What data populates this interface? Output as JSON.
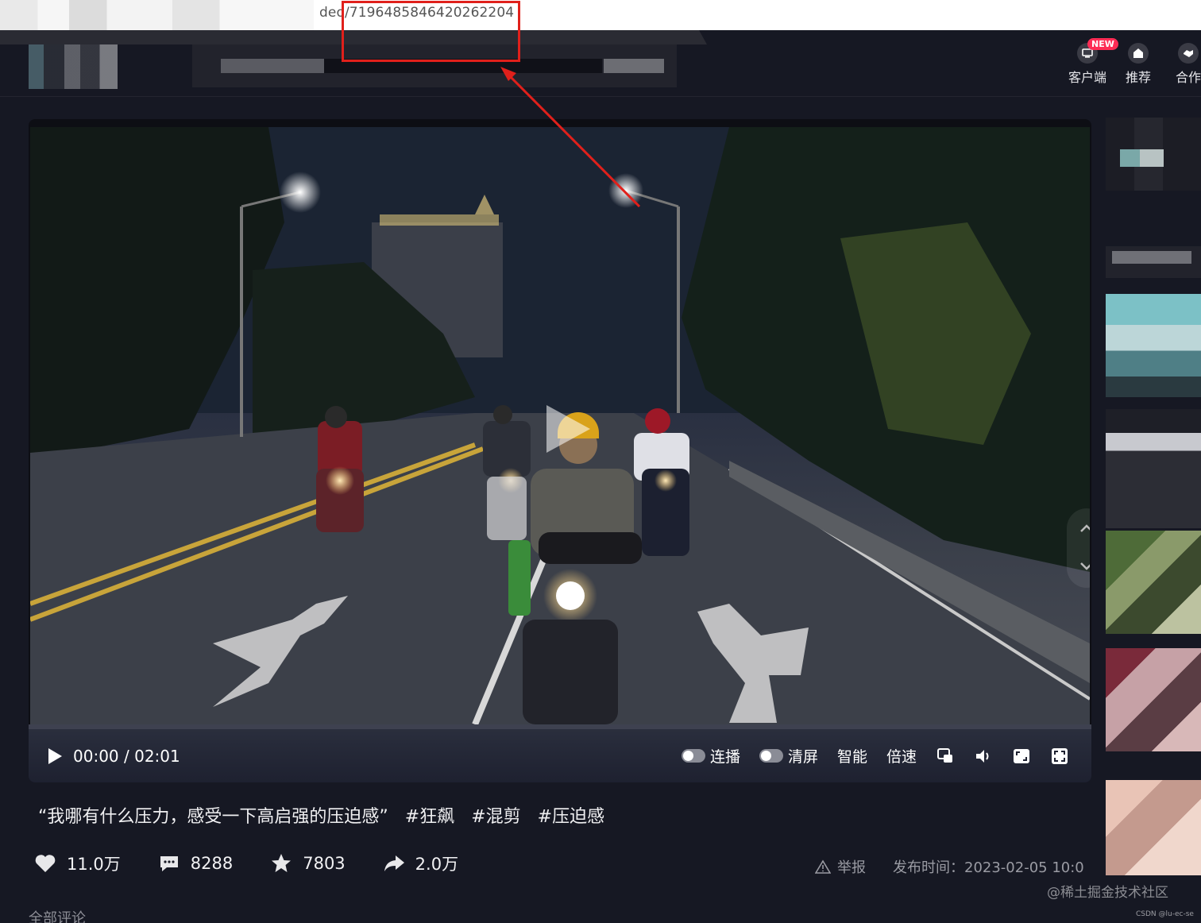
{
  "browser": {
    "url_suffix": "deo/7196485846420262204"
  },
  "header": {
    "nav": [
      {
        "label": "客户端",
        "icon": "download-icon"
      },
      {
        "label": "推荐",
        "icon": "home-icon"
      },
      {
        "label": "合作",
        "icon": "handshake-icon"
      }
    ],
    "new_badge": "NEW"
  },
  "player": {
    "time_current": "00:00",
    "time_separator": "/",
    "time_total": "02:01",
    "toggles": [
      {
        "label": "连播",
        "on": false
      },
      {
        "label": "清屏",
        "on": false
      }
    ],
    "smart_label": "智能",
    "speed_label": "倍速",
    "icons": [
      "pip-icon",
      "volume-icon",
      "webfullscreen-icon",
      "fullscreen-icon"
    ]
  },
  "video": {
    "caption": "“我哪有什么压力，感受一下高启强的压迫感”",
    "tags": [
      "#狂飙",
      "#混剪",
      "#压迫感"
    ]
  },
  "stats": {
    "likes": "11.0万",
    "comments": "8288",
    "favorites": "7803",
    "shares": "2.0万"
  },
  "meta": {
    "report_label": "举报",
    "publish_time": "发布时间：2023-02-05 10:0"
  },
  "comments": {
    "title": "全部评论"
  },
  "watermarks": {
    "juejin": "@稀土掘金技术社区",
    "csdn": "CSDN @lu-ec-se"
  },
  "colors": {
    "background": "#161823",
    "accent_red": "#fe2c55",
    "highlight_box": "#e0201b"
  }
}
